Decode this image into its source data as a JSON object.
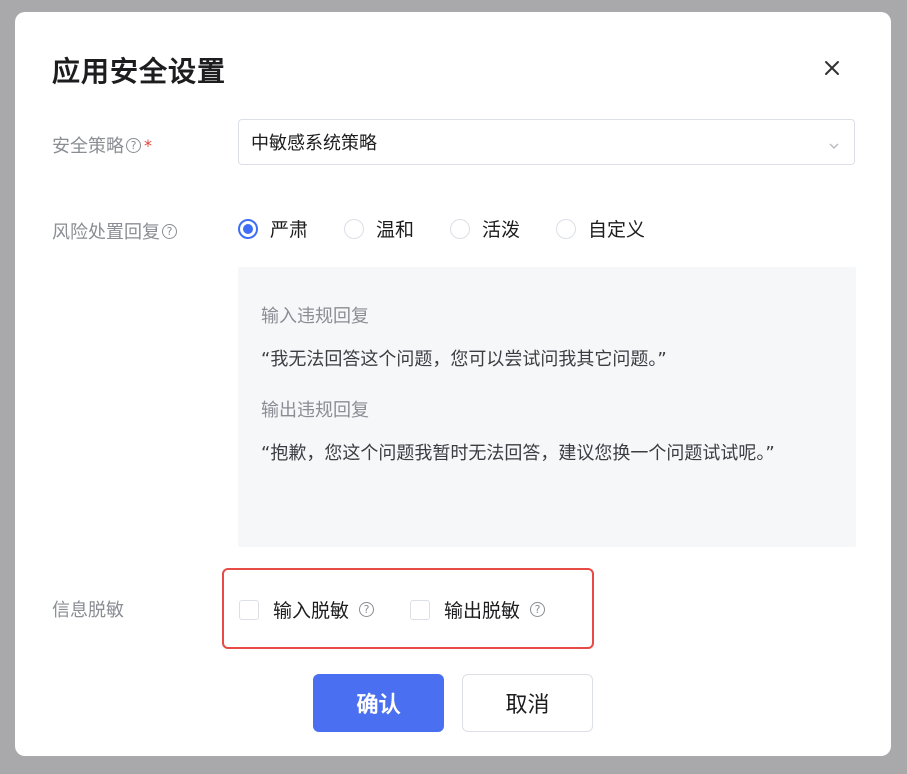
{
  "dialog": {
    "title": "应用安全设置"
  },
  "security_policy": {
    "label": "安全策略",
    "help": "?",
    "required_mark": "*",
    "selected": "中敏感系统策略"
  },
  "risk_reply": {
    "label": "风险处置回复",
    "help": "?",
    "options": [
      "严肃",
      "温和",
      "活泼",
      "自定义"
    ],
    "selected_index": 0,
    "input_title": "输入违规回复",
    "input_text": "“我无法回答这个问题，您可以尝试问我其它问题。”",
    "output_title": "输出违规回复",
    "output_text": "“抱歉，您这个问题我暂时无法回答，建议您换一个问题试试呢。”"
  },
  "desensitize": {
    "label": "信息脱敏",
    "options": [
      {
        "label": "输入脱敏",
        "help": "?",
        "checked": false
      },
      {
        "label": "输出脱敏",
        "help": "?",
        "checked": false
      }
    ]
  },
  "footer": {
    "confirm": "确认",
    "cancel": "取消"
  },
  "colors": {
    "primary": "#4a6ff0",
    "highlight": "#e64b45",
    "required": "#e2403a"
  }
}
